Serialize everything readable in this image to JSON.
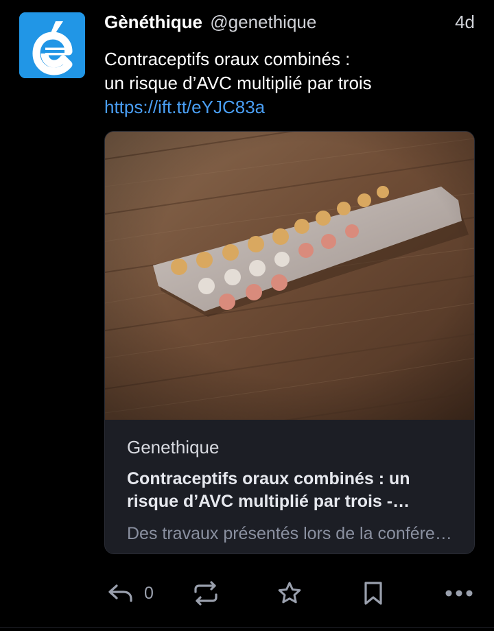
{
  "post": {
    "avatar_icon": "genethique-logo-icon",
    "avatar_letter": "é",
    "avatar_color": "#2196e6",
    "display_name": "Gènéthique",
    "handle": "@genethique",
    "timestamp": "4d",
    "text_line_1": "Contraceptifs oraux combinés :",
    "text_line_2": "un risque d’AVC multiplié par trois",
    "link_text": "https://ift.tt/eYJC83a",
    "link_color": "#4a9ff5"
  },
  "card": {
    "image_icon": "contraceptive-pill-blister-photo",
    "source": "Genethique",
    "title": "Contraceptifs oraux combinés : un risque d’AVC multiplié par trois - Gènéthique",
    "description": "Des travaux présentés lors de la conférence"
  },
  "actions": {
    "reply_icon": "reply-icon",
    "reply_count": "0",
    "boost_icon": "boost-icon",
    "favourite_icon": "star-icon",
    "bookmark_icon": "bookmark-icon",
    "more_icon": "more-icon",
    "icon_color": "#9aa0ad"
  }
}
